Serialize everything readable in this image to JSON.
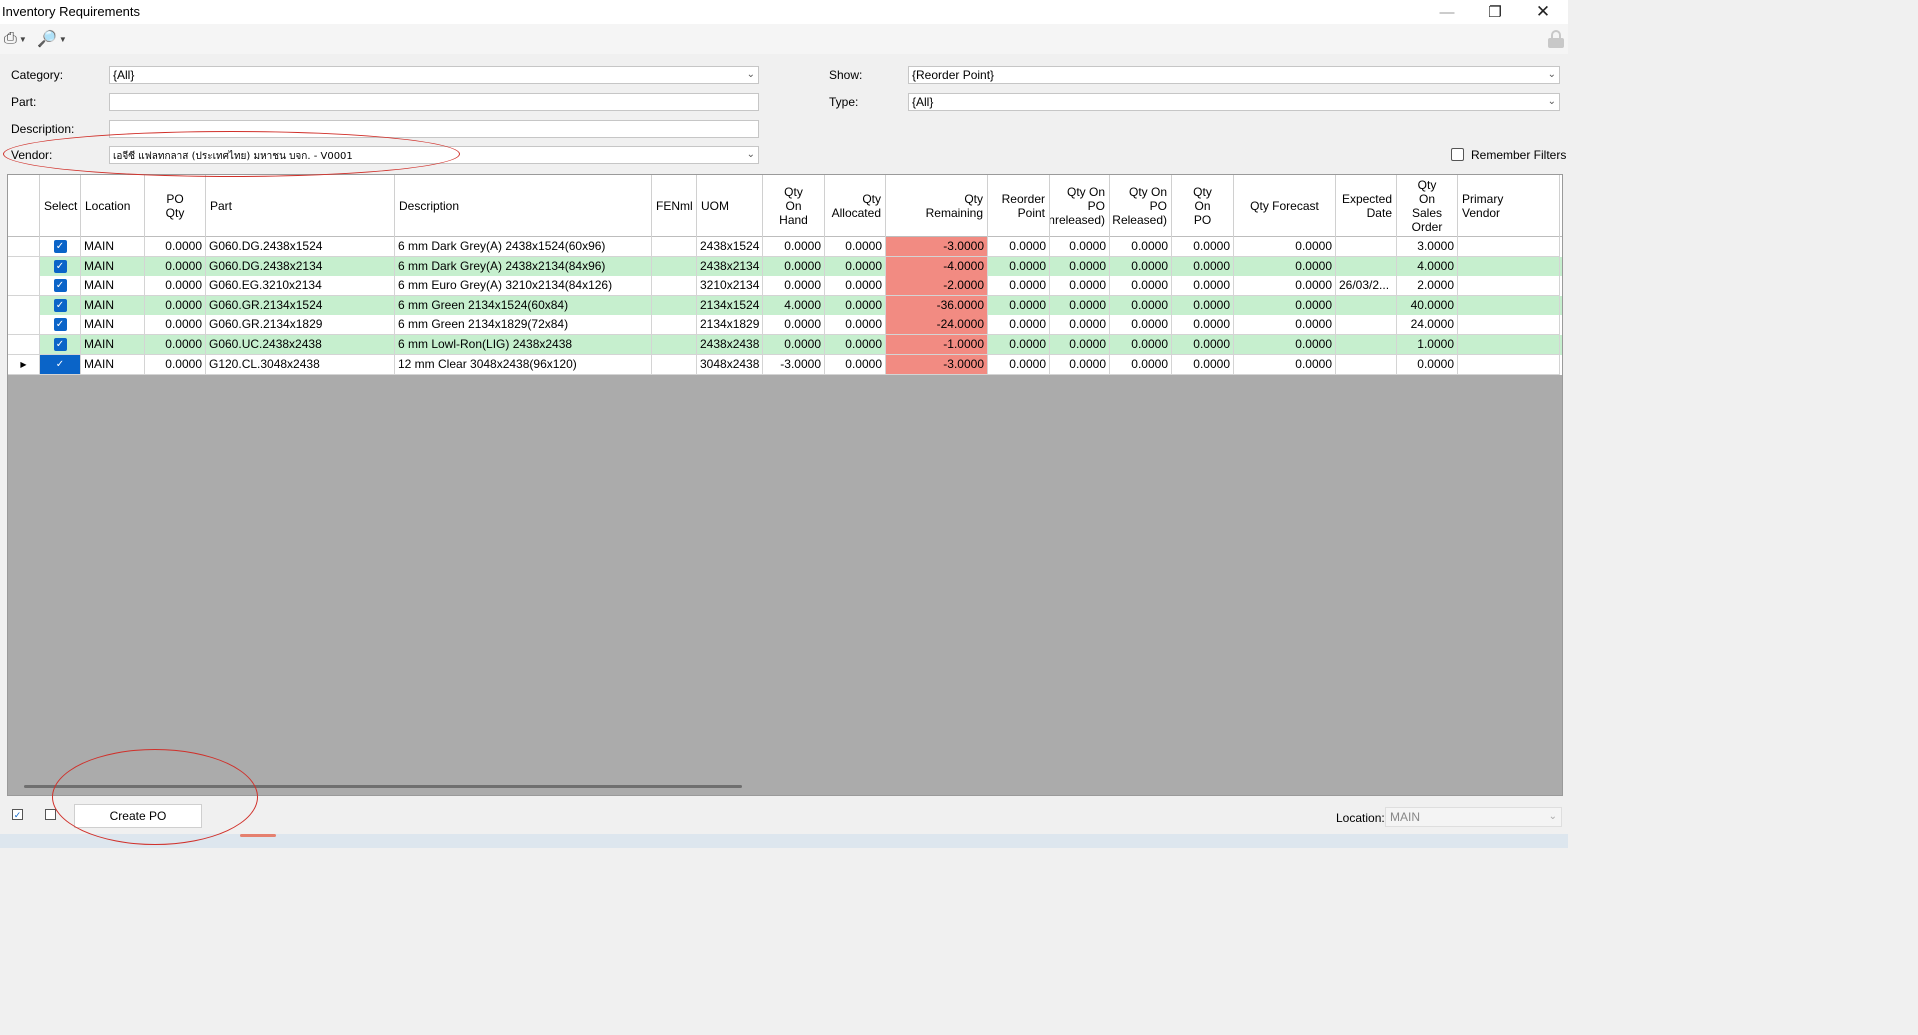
{
  "window": {
    "title": "Inventory Requirements"
  },
  "toolbar": {
    "print_icon": "printer-icon",
    "preview_icon": "print-preview-icon",
    "lock_icon": "lock-icon"
  },
  "filters": {
    "category_label": "Category:",
    "category_value": "{All}",
    "part_label": "Part:",
    "part_value": "",
    "description_label": "Description:",
    "description_value": "",
    "vendor_label": "Vendor:",
    "vendor_value": "เอจีซี แฟลทกลาส (ประเทศไทย) มหาชน บจก. - V0001",
    "show_label": "Show:",
    "show_value": "{Reorder Point}",
    "type_label": "Type:",
    "type_value": "{All}",
    "remember_filters_label": "Remember Filters"
  },
  "grid": {
    "columns": [
      {
        "key": "indicator",
        "label": ""
      },
      {
        "key": "select",
        "label": "Select"
      },
      {
        "key": "location",
        "label": "Location"
      },
      {
        "key": "po_qty",
        "label": "PO\nQty"
      },
      {
        "key": "part",
        "label": "Part"
      },
      {
        "key": "description",
        "label": "Description"
      },
      {
        "key": "fenml",
        "label": "FENml"
      },
      {
        "key": "uom",
        "label": "UOM"
      },
      {
        "key": "qty_on_hand",
        "label": "Qty\nOn\nHand"
      },
      {
        "key": "qty_allocated",
        "label": "Qty\nAllocated"
      },
      {
        "key": "qty_remaining",
        "label": "Qty\nRemaining"
      },
      {
        "key": "reorder_point",
        "label": "Reorder\nPoint"
      },
      {
        "key": "qty_on_po_unreleased",
        "label": "Qty On\nPO\nnreleased)"
      },
      {
        "key": "qty_on_po_released",
        "label": "Qty On\nPO\nReleased)"
      },
      {
        "key": "qty_on_po",
        "label": "Qty\nOn\nPO"
      },
      {
        "key": "qty_forecast",
        "label": "Qty Forecast"
      },
      {
        "key": "expected_date",
        "label": "Expected\nDate"
      },
      {
        "key": "qty_on_sales_order",
        "label": "Qty\nOn\nSales\nOrder"
      },
      {
        "key": "primary_vendor",
        "label": "Primary\nVendor"
      }
    ],
    "rows": [
      {
        "location": "MAIN",
        "po_qty": "0.0000",
        "part": "G060.DG.2438x1524",
        "description": "6 mm Dark Grey(A) 2438x1524(60x96)",
        "fenml": "",
        "uom": "2438x1524",
        "qty_on_hand": "0.0000",
        "qty_allocated": "0.0000",
        "qty_remaining": "-3.0000",
        "reorder_point": "0.0000",
        "qty_on_po_unreleased": "0.0000",
        "qty_on_po_released": "0.0000",
        "qty_on_po": "0.0000",
        "qty_forecast": "0.0000",
        "expected_date": "",
        "qty_on_sales_order": "3.0000",
        "primary_vendor": ""
      },
      {
        "location": "MAIN",
        "po_qty": "0.0000",
        "part": "G060.DG.2438x2134",
        "description": "6 mm Dark Grey(A) 2438x2134(84x96)",
        "fenml": "",
        "uom": "2438x2134",
        "qty_on_hand": "0.0000",
        "qty_allocated": "0.0000",
        "qty_remaining": "-4.0000",
        "reorder_point": "0.0000",
        "qty_on_po_unreleased": "0.0000",
        "qty_on_po_released": "0.0000",
        "qty_on_po": "0.0000",
        "qty_forecast": "0.0000",
        "expected_date": "",
        "qty_on_sales_order": "4.0000",
        "primary_vendor": ""
      },
      {
        "location": "MAIN",
        "po_qty": "0.0000",
        "part": "G060.EG.3210x2134",
        "description": "6 mm Euro Grey(A) 3210x2134(84x126)",
        "fenml": "",
        "uom": "3210x2134",
        "qty_on_hand": "0.0000",
        "qty_allocated": "0.0000",
        "qty_remaining": "-2.0000",
        "reorder_point": "0.0000",
        "qty_on_po_unreleased": "0.0000",
        "qty_on_po_released": "0.0000",
        "qty_on_po": "0.0000",
        "qty_forecast": "0.0000",
        "expected_date": "26/03/2...",
        "qty_on_sales_order": "2.0000",
        "primary_vendor": ""
      },
      {
        "location": "MAIN",
        "po_qty": "0.0000",
        "part": "G060.GR.2134x1524",
        "description": "6 mm Green 2134x1524(60x84)",
        "fenml": "",
        "uom": "2134x1524",
        "qty_on_hand": "4.0000",
        "qty_allocated": "0.0000",
        "qty_remaining": "-36.0000",
        "reorder_point": "0.0000",
        "qty_on_po_unreleased": "0.0000",
        "qty_on_po_released": "0.0000",
        "qty_on_po": "0.0000",
        "qty_forecast": "0.0000",
        "expected_date": "",
        "qty_on_sales_order": "40.0000",
        "primary_vendor": ""
      },
      {
        "location": "MAIN",
        "po_qty": "0.0000",
        "part": "G060.GR.2134x1829",
        "description": "6 mm Green 2134x1829(72x84)",
        "fenml": "",
        "uom": "2134x1829",
        "qty_on_hand": "0.0000",
        "qty_allocated": "0.0000",
        "qty_remaining": "-24.0000",
        "reorder_point": "0.0000",
        "qty_on_po_unreleased": "0.0000",
        "qty_on_po_released": "0.0000",
        "qty_on_po": "0.0000",
        "qty_forecast": "0.0000",
        "expected_date": "",
        "qty_on_sales_order": "24.0000",
        "primary_vendor": ""
      },
      {
        "location": "MAIN",
        "po_qty": "0.0000",
        "part": "G060.UC.2438x2438",
        "description": "6 mm Lowl-Ron(LIG) 2438x2438",
        "fenml": "",
        "uom": "2438x2438",
        "qty_on_hand": "0.0000",
        "qty_allocated": "0.0000",
        "qty_remaining": "-1.0000",
        "reorder_point": "0.0000",
        "qty_on_po_unreleased": "0.0000",
        "qty_on_po_released": "0.0000",
        "qty_on_po": "0.0000",
        "qty_forecast": "0.0000",
        "expected_date": "",
        "qty_on_sales_order": "1.0000",
        "primary_vendor": ""
      },
      {
        "location": "MAIN",
        "po_qty": "0.0000",
        "part": "G120.CL.3048x2438",
        "description": "12 mm Clear 3048x2438(96x120)",
        "fenml": "",
        "uom": "3048x2438",
        "qty_on_hand": "-3.0000",
        "qty_allocated": "0.0000",
        "qty_remaining": "-3.0000",
        "reorder_point": "0.0000",
        "qty_on_po_unreleased": "0.0000",
        "qty_on_po_released": "0.0000",
        "qty_on_po": "0.0000",
        "qty_forecast": "0.0000",
        "expected_date": "",
        "qty_on_sales_order": "0.0000",
        "primary_vendor": ""
      }
    ],
    "row_styles": [
      "white",
      "green",
      "white",
      "green",
      "white",
      "green",
      "white"
    ]
  },
  "bottom": {
    "create_po_label": "Create PO",
    "location_label": "Location:",
    "location_value": "MAIN"
  },
  "colors": {
    "negative_remaining": "#f28b82",
    "alt_row": "#c6efce",
    "select_blue": "#0a64c8",
    "annotation": "#d0302a"
  }
}
